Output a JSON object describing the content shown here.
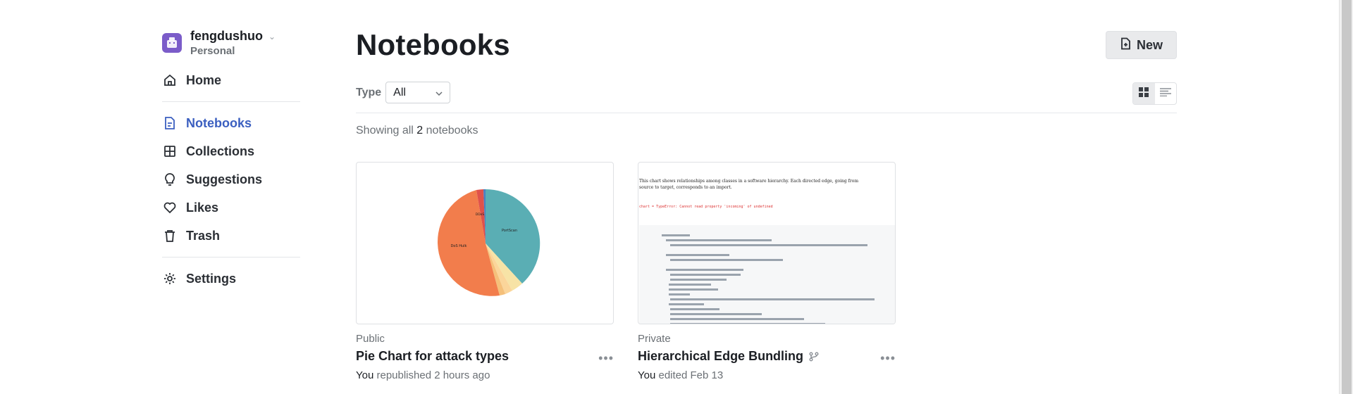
{
  "workspace": {
    "name": "fengdushuo",
    "type": "Personal"
  },
  "nav": {
    "home": "Home",
    "notebooks": "Notebooks",
    "collections": "Collections",
    "suggestions": "Suggestions",
    "likes": "Likes",
    "trash": "Trash",
    "settings": "Settings"
  },
  "page": {
    "title": "Notebooks",
    "new_label": "New",
    "filter_label": "Type",
    "filter_value": "All",
    "showing_prefix": "Showing all",
    "showing_count": "2",
    "showing_suffix": "notebooks"
  },
  "notebooks": [
    {
      "visibility": "Public",
      "title": "Pie Chart for attack types",
      "who": "You",
      "action": "republished 2 hours ago",
      "pie_labels": {
        "dos_hulk": "DoS Hulk",
        "portscan": "PortScan",
        "ddos": "DDoS"
      }
    },
    {
      "visibility": "Private",
      "title": "Hierarchical Edge Bundling",
      "who": "You",
      "action": "edited Feb 13",
      "preview_intro": "This chart shows relationships among classes in a software hierarchy. Each directed edge, going from source to target, corresponds to an import.",
      "preview_error": "chart = TypeError: Cannot read property 'incoming' of undefined"
    }
  ],
  "colors": {
    "accent": "#3b5fc0",
    "avatar": "#7b5cc9"
  }
}
